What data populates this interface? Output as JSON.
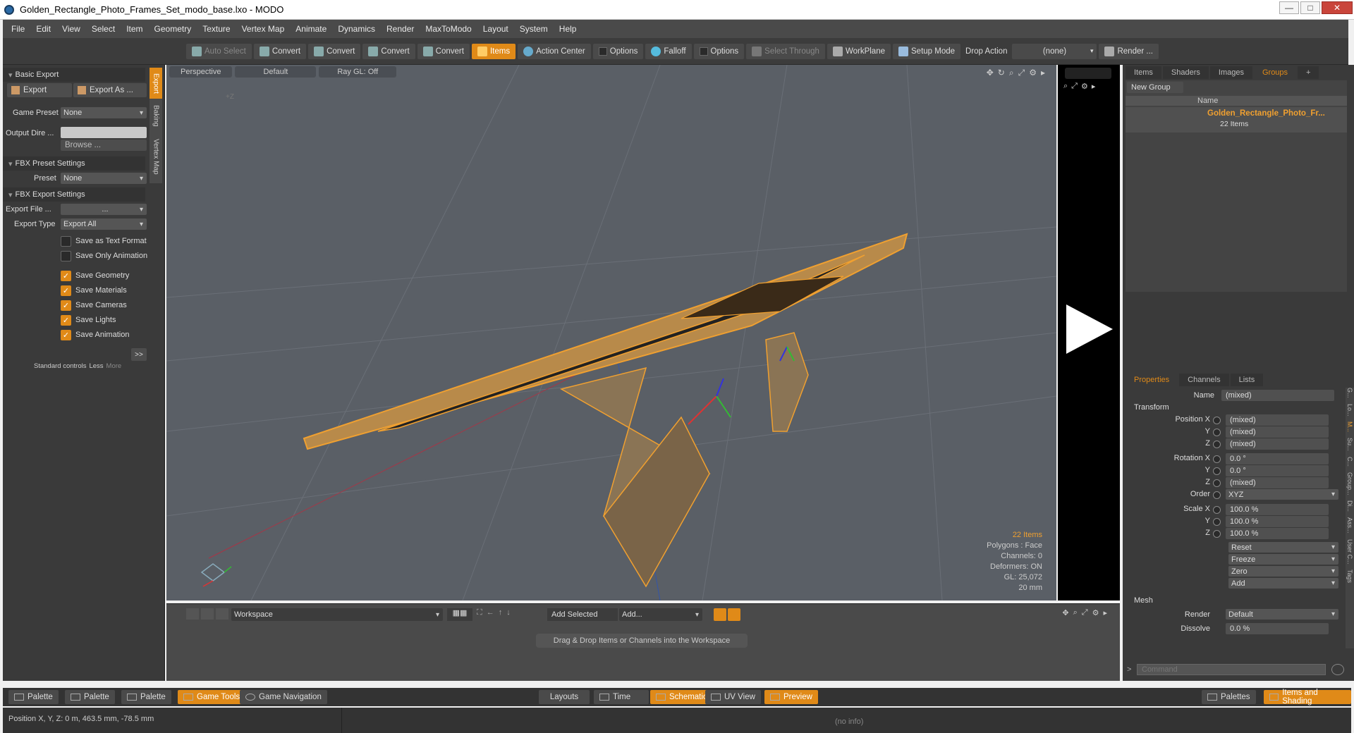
{
  "window": {
    "title": "Golden_Rectangle_Photo_Frames_Set_modo_base.lxo - MODO"
  },
  "menu": [
    "File",
    "Edit",
    "View",
    "Select",
    "Item",
    "Geometry",
    "Texture",
    "Vertex Map",
    "Animate",
    "Dynamics",
    "Render",
    "MaxToModo",
    "Layout",
    "System",
    "Help"
  ],
  "toolbar": {
    "auto_select": "Auto Select",
    "convert1": "Convert",
    "convert2": "Convert",
    "convert3": "Convert",
    "convert4": "Convert",
    "items": "Items",
    "action_center": "Action Center",
    "options1": "Options",
    "falloff": "Falloff",
    "options2": "Options",
    "select_through": "Select Through",
    "workplane": "WorkPlane",
    "setup_mode": "Setup Mode",
    "drop_action_label": "Drop Action",
    "drop_action_value": "(none)",
    "render": "Render ..."
  },
  "left": {
    "basic_export": "Basic Export",
    "export": "Export",
    "export_as": "Export As ...",
    "game_preset_label": "Game Preset",
    "game_preset_value": "None",
    "output_dir_label": "Output Dire ...",
    "browse": "Browse ...",
    "fbx_preset_settings": "FBX Preset Settings",
    "preset_label": "Preset",
    "preset_value": "None",
    "fbx_export_settings": "FBX Export Settings",
    "export_file_label": "Export File ...",
    "export_file_value": "...",
    "export_type_label": "Export Type",
    "export_type_value": "Export All",
    "save_text": "Save as Text Format",
    "save_only_anim": "Save Only Animation",
    "save_geometry": "Save Geometry",
    "save_materials": "Save Materials",
    "save_cameras": "Save Cameras",
    "save_lights": "Save Lights",
    "save_animation": "Save Animation",
    "expand": ">>",
    "standard_controls": "Standard controls",
    "less": "Less",
    "more": "More",
    "vtab_export": "Export",
    "vtab_baking": "Baking",
    "vtab_vertex": "Vertex Map"
  },
  "viewport": {
    "perspective": "Perspective",
    "default": "Default",
    "raygl": "Ray GL: Off",
    "axis_label": "+Z",
    "items_count": "22 Items",
    "polygons": "Polygons : Face",
    "channels": "Channels: 0",
    "deformers": "Deformers: ON",
    "gl": "GL: 25,072",
    "scale": "20 mm"
  },
  "workspace": {
    "dropdown": "Workspace",
    "add_selected": "Add Selected",
    "add": "Add...",
    "hint": "Drag & Drop Items or Channels into the Workspace"
  },
  "right": {
    "tabs": [
      "Items",
      "Shaders",
      "Images",
      "Groups"
    ],
    "new_group": "New Group",
    "name_col": "Name",
    "group_name": "Golden_Rectangle_Photo_Fr...",
    "group_count": "22 Items",
    "prop_tabs": [
      "Properties",
      "Channels",
      "Lists"
    ],
    "name_label": "Name",
    "name_value": "(mixed)",
    "transform": "Transform",
    "position_x_label": "Position X",
    "position_x": "(mixed)",
    "position_y": "(mixed)",
    "position_z": "(mixed)",
    "rotation_x_label": "Rotation X",
    "rotation_x": "0.0 °",
    "rotation_y": "0.0 °",
    "rotation_z": "(mixed)",
    "order_label": "Order",
    "order_value": "XYZ",
    "scale_x_label": "Scale X",
    "scale_x": "100.0 %",
    "scale_y": "100.0 %",
    "scale_z": "100.0 %",
    "y": "Y",
    "z": "Z",
    "reset": "Reset",
    "freeze": "Freeze",
    "zero": "Zero",
    "add": "Add",
    "mesh": "Mesh",
    "render_label": "Render",
    "render_value": "Default",
    "dissolve_label": "Dissolve",
    "dissolve_value": "0.0 %",
    "command_placeholder": "Command",
    "side_tabs": [
      "G...",
      "Lo...",
      "M...",
      "Su...",
      "C...",
      "Group...",
      "Di...",
      "Ass...",
      "User C...",
      "Tags"
    ]
  },
  "bottom": {
    "palette1": "Palette",
    "palette2": "Palette",
    "palette3": "Palette",
    "game_tools": "Game Tools",
    "game_navigation": "Game Navigation",
    "layouts": "Layouts",
    "time": "Time",
    "schematic": "Schematic",
    "uv_view": "UV View",
    "preview": "Preview",
    "palettes": "Palettes",
    "items_shading": "Items and Shading"
  },
  "status": {
    "position": "Position X, Y, Z:  0 m, 463.5 mm, -78.5 mm",
    "info": "(no info)"
  },
  "colors": {
    "accent": "#e08a18",
    "panel": "#3a3a3a",
    "viewport": "#5a5f66"
  }
}
